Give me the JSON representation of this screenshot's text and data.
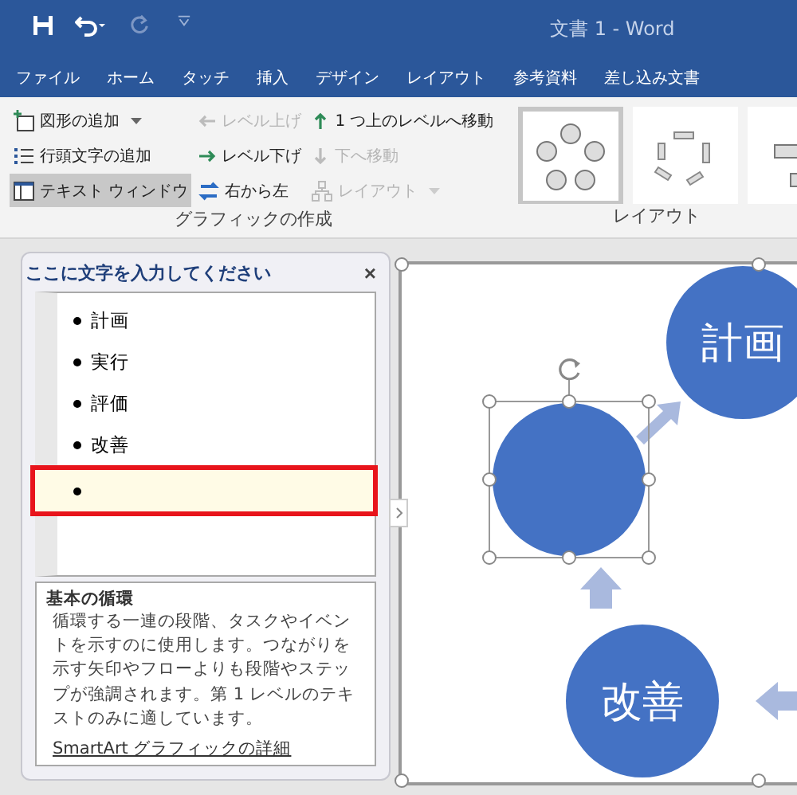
{
  "title_bar": {
    "title": "文書 1  -  Word"
  },
  "ribbon_tabs": [
    {
      "label": "ファイル"
    },
    {
      "label": "ホーム"
    },
    {
      "label": "タッチ"
    },
    {
      "label": "挿入"
    },
    {
      "label": "デザイン"
    },
    {
      "label": "レイアウト"
    },
    {
      "label": "参考資料"
    },
    {
      "label": "差し込み文書"
    }
  ],
  "create_group": {
    "caption": "グラフィックの作成",
    "columns": [
      [
        {
          "kind": "add-shape",
          "label": "図形の追加",
          "disabled": false,
          "selected": false
        },
        {
          "kind": "bullet",
          "label": "行頭文字の追加",
          "disabled": false,
          "selected": false
        },
        {
          "kind": "pane",
          "label": "テキスト ウィンドウ",
          "disabled": false,
          "selected": true
        }
      ],
      [
        {
          "kind": "left",
          "label": "レベル上げ",
          "disabled": true,
          "selected": false
        },
        {
          "kind": "right",
          "label": "レベル下げ",
          "disabled": false,
          "selected": false
        },
        {
          "kind": "rtl",
          "label": "右から左",
          "disabled": false,
          "selected": false
        }
      ],
      [
        {
          "kind": "up",
          "label": "1 つ上のレベルへ移動",
          "disabled": false,
          "selected": false
        },
        {
          "kind": "down",
          "label": "下へ移動",
          "disabled": true,
          "selected": false
        },
        {
          "kind": "layout",
          "label": "レイアウト",
          "disabled": true,
          "selected": false
        }
      ]
    ]
  },
  "layout_group": {
    "caption": "レイアウト",
    "thumbnails": [
      {
        "selected": true
      },
      {
        "selected": false
      },
      {
        "selected": false
      }
    ]
  },
  "text_pane": {
    "title": "ここに文字を入力してください",
    "close": "×",
    "items": [
      {
        "text": "計画",
        "selected": false
      },
      {
        "text": "実行",
        "selected": false
      },
      {
        "text": "評価",
        "selected": false
      },
      {
        "text": "改善",
        "selected": false
      },
      {
        "selected": true
      }
    ],
    "info_title": "基本の循環",
    "info_body": "循環する一連の段階、タスクやイベントを示すのに使用します。つながりを示す矢印やフローよりも段階やステップが強調されます。第 1 レベルのテキストのみに適しています。",
    "info_link": "SmartArt グラフィックの詳細"
  },
  "canvas": {
    "nodes": [
      {
        "label": "計画",
        "selected": false
      },
      {
        "selected": true
      },
      {
        "label": "改善",
        "selected": false
      }
    ]
  }
}
